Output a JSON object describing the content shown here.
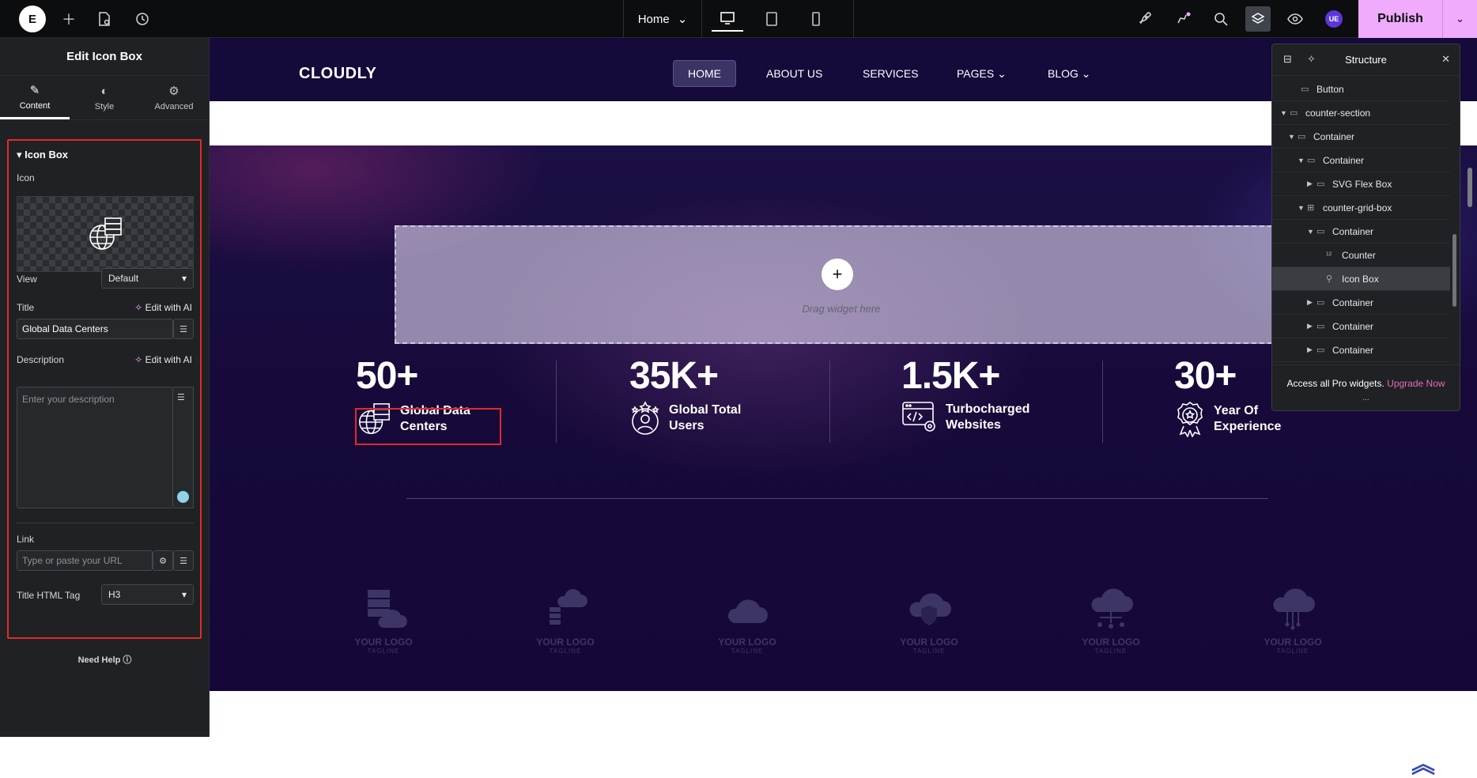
{
  "topbar": {
    "page": "Home",
    "publish": "Publish",
    "user_badge": "UE",
    "icons": [
      "elementor-logo-icon",
      "plus-icon",
      "page-settings-icon",
      "history-icon",
      "desktop-icon",
      "tablet-icon",
      "mobile-icon",
      "rocket-icon",
      "notifications-icon",
      "search-icon",
      "layers-icon",
      "preview-eye-icon",
      "chevron-down-icon"
    ]
  },
  "panel": {
    "title": "Edit Icon Box",
    "tabs": [
      {
        "label": "Content"
      },
      {
        "label": "Style"
      },
      {
        "label": "Advanced"
      }
    ],
    "section": "Icon Box",
    "icon_label": "Icon",
    "view_label": "View",
    "view_value": "Default",
    "title_label": "Title",
    "edit_ai": "Edit with AI",
    "title_value": "Global Data Centers",
    "desc_label": "Description",
    "desc_placeholder": "Enter your description",
    "link_label": "Link",
    "link_placeholder": "Type or paste your URL",
    "tag_label": "Title HTML Tag",
    "tag_value": "H3",
    "need_help": "Need Help"
  },
  "site": {
    "brand": "CLOUDLY",
    "nav": [
      {
        "label": "HOME"
      },
      {
        "label": "ABOUT US"
      },
      {
        "label": "SERVICES"
      },
      {
        "label": "PAGES"
      },
      {
        "label": "BLOG"
      }
    ],
    "drag_text": "Drag widget here",
    "stats": [
      {
        "num": "50+",
        "l1": "Global Data",
        "l2": "Centers"
      },
      {
        "num": "35K+",
        "l1": "Global Total",
        "l2": "Users"
      },
      {
        "num": "1.5K+",
        "l1": "Turbocharged",
        "l2": "Websites"
      },
      {
        "num": "30+",
        "l1": "Year Of",
        "l2": "Experience"
      }
    ],
    "logo_text": "YOUR LOGO",
    "logo_tag": "TAGLINE"
  },
  "structure": {
    "title": "Structure",
    "rows": [
      {
        "label": "Button"
      },
      {
        "label": "counter-section"
      },
      {
        "label": "Container"
      },
      {
        "label": "Container"
      },
      {
        "label": "SVG Flex Box"
      },
      {
        "label": "counter-grid-box"
      },
      {
        "label": "Container"
      },
      {
        "label": "Counter"
      },
      {
        "label": "Icon Box"
      },
      {
        "label": "Container"
      },
      {
        "label": "Container"
      },
      {
        "label": "Container"
      }
    ],
    "footer": "Access all Pro widgets.",
    "upgrade": "Upgrade Now",
    "more": "..."
  },
  "colors": {
    "accent": "#f0abfc",
    "highlight": "#e02b2b",
    "hero": "#170a3a"
  }
}
